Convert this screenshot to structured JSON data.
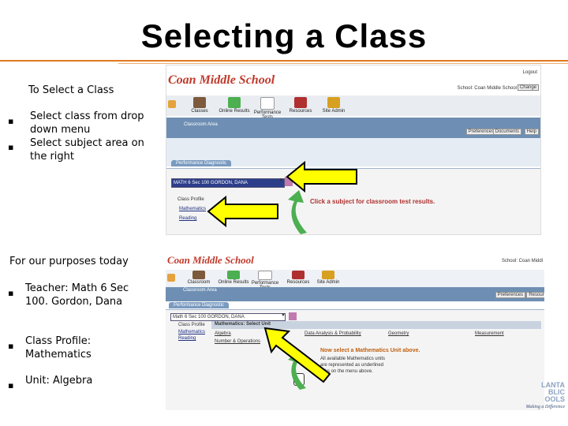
{
  "slide": {
    "title": "Selecting a Class",
    "intro_label": "To Select a Class",
    "steps": [
      "Select class from drop down menu",
      "Select subject area on the right"
    ],
    "purposes_label": "For our purposes today",
    "purposes": [
      "Teacher: Math 6 Sec 100. Gordon, Dana",
      "Class Profile: Mathematics",
      "Unit: Algebra"
    ],
    "bullet_char": "▪"
  },
  "screenshot_top": {
    "school_name": "Coan Middle School",
    "logout": "Logout",
    "school_select_label": "School: Coan Middle School",
    "change_btn": "Change",
    "toolbar": [
      "Classes",
      "Online Results",
      "Performance Tests",
      "Resources",
      "Site Admin"
    ],
    "area_title": "Classroom Area",
    "area_buttons": [
      "Preferences",
      "Documents",
      "Help"
    ],
    "tab_label": "Performance Diagnostic",
    "class_select_value": "MATH 6 Sec 100 GORDON, DANA",
    "profile_label": "Class Profile",
    "profile_items": [
      "Mathematics",
      "Reading"
    ],
    "hint": "Click a subject for classroom test results."
  },
  "screenshot_bottom": {
    "school_name": "Coan Middle School",
    "school_select_label": "School: Coan Middl",
    "toolbar": [
      "Classroom",
      "Online Results",
      "Performance Tests",
      "Resources",
      "Site Admin"
    ],
    "area_title": "Classroom Area",
    "area_buttons": [
      "Preferences",
      "Resources"
    ],
    "tab_label": "Performance Diagnostic",
    "class_select_value": "Math 6 Sec 100 GORDON, DANA",
    "profile_label": "Class Profile",
    "profile_items": [
      "Mathematics",
      "Reading"
    ],
    "unit_header": "Mathematics: Select Unit",
    "units": [
      "Algebra",
      "Data Analysis & Probability",
      "Geometry",
      "Measurement",
      "Number & Operations"
    ],
    "hint_title": "Now select a Mathematics Unit above.",
    "hint_body": "All available Mathematics units are represented as underlined links on the menu above."
  },
  "footer_logo": {
    "text_lines": [
      "LANTA",
      "BLIC",
      "OOLS"
    ],
    "tagline": "Making a Difference"
  },
  "colors": {
    "accent_orange": "#e07a20",
    "nav_blue": "#6e8fb3",
    "arrow_yellow": "#ffff00",
    "school_red": "#c0392b",
    "green_arrow": "#4caf50"
  }
}
